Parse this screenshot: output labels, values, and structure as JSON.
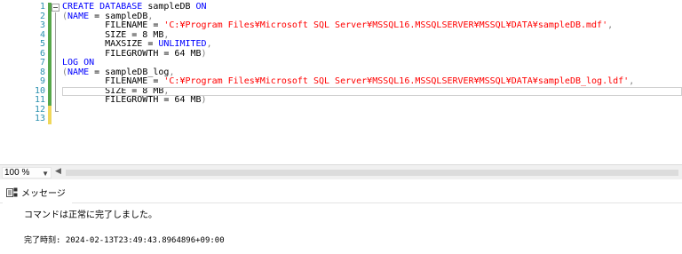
{
  "editor": {
    "line_numbers": [
      "1",
      "2",
      "3",
      "4",
      "5",
      "6",
      "7",
      "8",
      "9",
      "10",
      "11",
      "12",
      "13"
    ],
    "lines": [
      [
        {
          "t": "CREATE DATABASE",
          "c": "kw"
        },
        {
          "t": " sampleDB ",
          "c": "id"
        },
        {
          "t": "ON",
          "c": "kw"
        }
      ],
      [
        {
          "t": "(",
          "c": "gr"
        },
        {
          "t": "NAME",
          "c": "kw"
        },
        {
          "t": " = sampleDB",
          "c": "id"
        },
        {
          "t": ",",
          "c": "gr"
        }
      ],
      [
        {
          "t": "        FILENAME = ",
          "c": "id"
        },
        {
          "t": "'C:¥Program Files¥Microsoft SQL Server¥MSSQL16.MSSQLSERVER¥MSSQL¥DATA¥sampleDB.mdf'",
          "c": "str"
        },
        {
          "t": ",",
          "c": "gr"
        }
      ],
      [
        {
          "t": "        SIZE = 8 MB",
          "c": "id"
        },
        {
          "t": ",",
          "c": "gr"
        }
      ],
      [
        {
          "t": "        MAXSIZE = ",
          "c": "id"
        },
        {
          "t": "UNLIMITED",
          "c": "kw"
        },
        {
          "t": ",",
          "c": "gr"
        }
      ],
      [
        {
          "t": "        FILEGROWTH = 64 MB",
          "c": "id"
        },
        {
          "t": ")",
          "c": "gr"
        }
      ],
      [
        {
          "t": "LOG ON",
          "c": "kw"
        }
      ],
      [
        {
          "t": "(",
          "c": "gr"
        },
        {
          "t": "NAME",
          "c": "kw"
        },
        {
          "t": " = sampleDB_log",
          "c": "id"
        },
        {
          "t": ",",
          "c": "gr"
        }
      ],
      [
        {
          "t": "        FILENAME = ",
          "c": "id"
        },
        {
          "t": "'C:¥Program Files¥Microsoft SQL Server¥MSSQL16.MSSQLSERVER¥MSSQL¥DATA¥sampleDB_log.ldf'",
          "c": "str"
        },
        {
          "t": ",",
          "c": "gr"
        }
      ],
      [
        {
          "t": "        SIZE = 8 MB",
          "c": "id"
        },
        {
          "t": ",",
          "c": "gr"
        }
      ],
      [
        {
          "t": "        FILEGROWTH = 64 MB",
          "c": "id"
        },
        {
          "t": ")",
          "c": "gr"
        }
      ],
      [],
      []
    ],
    "current_line": 10,
    "change_markers": [
      "saved",
      "saved",
      "saved",
      "saved",
      "saved",
      "saved",
      "saved",
      "saved",
      "saved",
      "saved",
      "saved",
      "unsaved",
      "unsaved"
    ],
    "colors": {
      "keyword": "#0000ff",
      "string": "#ff0000",
      "operator": "#808080",
      "line_number": "#2b91af"
    }
  },
  "zoom": {
    "value": "100 %"
  },
  "results": {
    "tab_label": "メッセージ",
    "message": "コマンドは正常に完了しました。",
    "completion_time": "完了時刻: 2024-02-13T23:49:43.8964896+09:00"
  }
}
